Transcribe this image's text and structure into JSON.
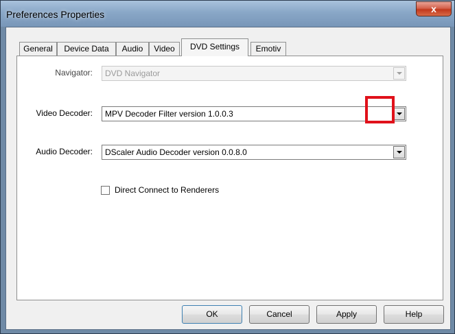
{
  "window": {
    "title": "Preferences Properties",
    "close_label": "x"
  },
  "tabs": [
    {
      "label": "General",
      "active": false
    },
    {
      "label": "Device Data",
      "active": false
    },
    {
      "label": "Audio",
      "active": false
    },
    {
      "label": "Video",
      "active": false
    },
    {
      "label": "DVD Settings",
      "active": true
    },
    {
      "label": "Emotiv",
      "active": false
    }
  ],
  "form": {
    "navigator": {
      "label": "Navigator:",
      "value": "DVD Navigator",
      "enabled": false
    },
    "video_decoder": {
      "label": "Video Decoder:",
      "value": "MPV Decoder Filter version 1.0.0.3",
      "enabled": true
    },
    "audio_decoder": {
      "label": "Audio Decoder:",
      "value": "DScaler Audio Decoder version 0.0.8.0",
      "enabled": true
    },
    "direct_connect": {
      "label": "Direct Connect to Renderers",
      "checked": false
    }
  },
  "buttons": {
    "ok": "OK",
    "cancel": "Cancel",
    "apply": "Apply",
    "help": "Help"
  },
  "colors": {
    "highlight": "#e0111a",
    "titlebar": "#89a7c7",
    "panel": "#f0f0f0"
  }
}
